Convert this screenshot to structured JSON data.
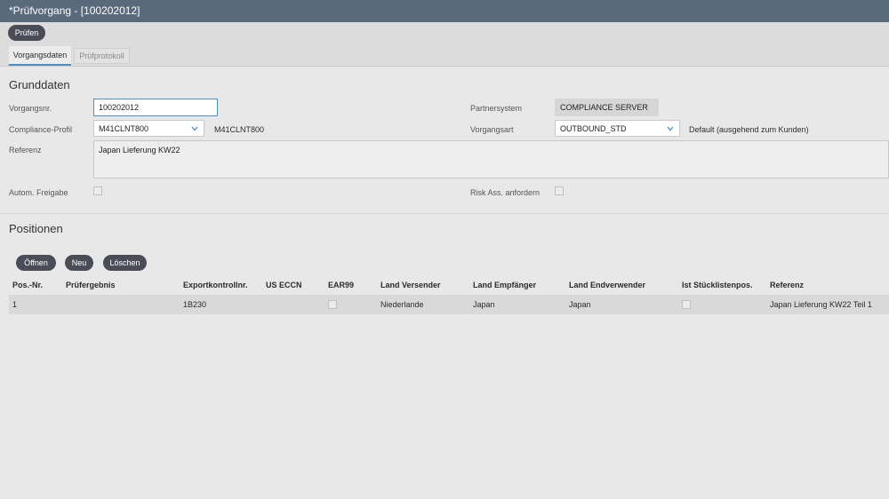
{
  "window": {
    "title": "*Prüfvorgang - [100202012]"
  },
  "toolbar": {
    "pruefen_label": "Prüfen"
  },
  "tabs": [
    {
      "label": "Vorgangsdaten",
      "active": true
    },
    {
      "label": "Prüfprotokoll",
      "active": false
    }
  ],
  "grunddaten": {
    "title": "Grunddaten",
    "vorgangsnr_label": "Vorgangsnr.",
    "vorgangsnr_value": "100202012",
    "compliance_profil_label": "Compliance-Profil",
    "compliance_profil_value": "M41CLNT800",
    "compliance_profil_desc": "M41CLNT800",
    "referenz_label": "Referenz",
    "referenz_value": "Japan Lieferung KW22",
    "autom_freigabe_label": "Autom. Freigabe",
    "autom_freigabe_checked": false,
    "partnersystem_label": "Partnersystem",
    "partnersystem_value": "COMPLIANCE SERVER",
    "vorgangsart_label": "Vorgangsart",
    "vorgangsart_value": "OUTBOUND_STD",
    "vorgangsart_desc": "Default (ausgehend zum Kunden)",
    "risk_ass_label": "Risk Ass. anfordern",
    "risk_ass_checked": false
  },
  "positionen": {
    "title": "Positionen",
    "buttons": {
      "oeffnen": "Öffnen",
      "neu": "Neu",
      "loeschen": "Löschen"
    },
    "columns": [
      "Pos.-Nr.",
      "Prüfergebnis",
      "Exportkontrollnr.",
      "US ECCN",
      "EAR99",
      "Land Versender",
      "Land Empfänger",
      "Land Endverwender",
      "Ist Stücklistenpos.",
      "Referenz"
    ],
    "rows": [
      {
        "pos_nr": "1",
        "pruefergebnis": "",
        "exportkontrollnr": "1B230",
        "us_eccn": "",
        "ear99": false,
        "land_versender": "Niederlande",
        "land_empfaenger": "Japan",
        "land_endverwender": "Japan",
        "ist_stuecklistenpos": false,
        "referenz": "Japan Lieferung KW22 Teil 1"
      }
    ]
  },
  "icons": {
    "select_arrow": "chevron-down-icon"
  },
  "colors": {
    "titlebar": "#5a6a7d",
    "button": "#4a4d57",
    "focus": "#4a90c8"
  }
}
